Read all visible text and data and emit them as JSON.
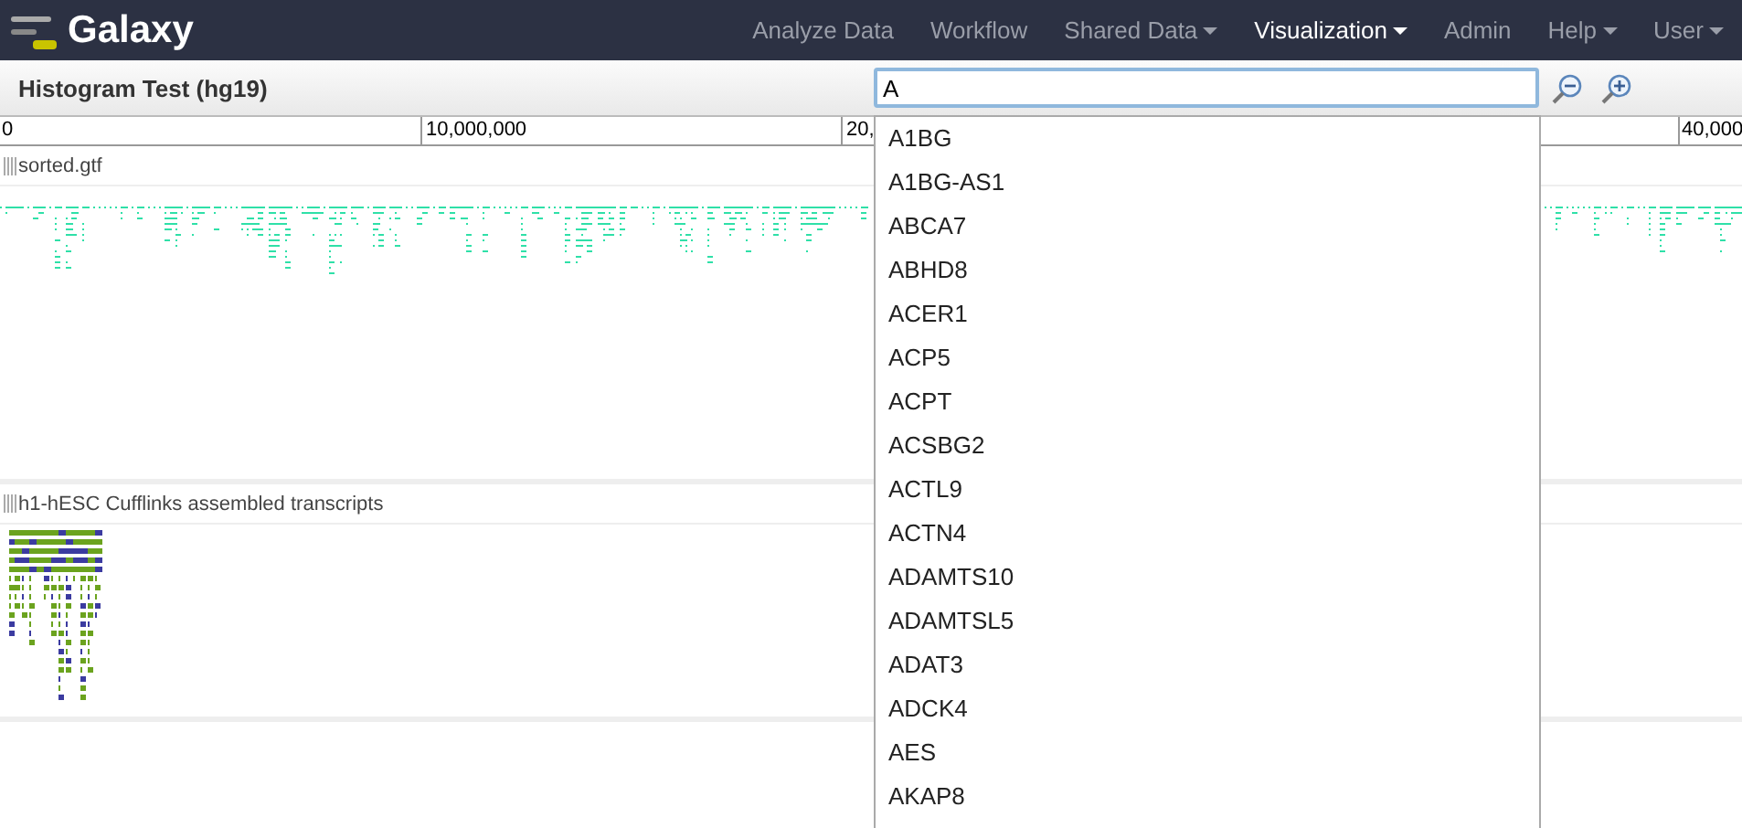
{
  "navbar": {
    "brand": "Galaxy",
    "items": [
      {
        "label": "Analyze Data",
        "has_menu": false,
        "selected": false
      },
      {
        "label": "Workflow",
        "has_menu": false,
        "selected": false
      },
      {
        "label": "Shared Data",
        "has_menu": true,
        "selected": false
      },
      {
        "label": "Visualization",
        "has_menu": true,
        "selected": true
      },
      {
        "label": "Admin",
        "has_menu": false,
        "selected": false
      },
      {
        "label": "Help",
        "has_menu": true,
        "selected": false
      },
      {
        "label": "User",
        "has_menu": true,
        "selected": false
      }
    ]
  },
  "title": "Histogram Test (hg19)",
  "search": {
    "value": "A"
  },
  "ruler": [
    "0",
    "10,000,000",
    "20,",
    "40,000"
  ],
  "tracks": [
    {
      "name": "sorted.gtf",
      "kind": "dense"
    },
    {
      "name": "h1-hESC Cufflinks assembled transcripts",
      "kind": "transcripts"
    }
  ],
  "suggestions": [
    "A1BG",
    "A1BG-AS1",
    "ABCA7",
    "ABHD8",
    "ACER1",
    "ACP5",
    "ACPT",
    "ACSBG2",
    "ACTL9",
    "ACTN4",
    "ADAMTS10",
    "ADAMTSL5",
    "ADAT3",
    "ADCK4",
    "AES",
    "AKAP8"
  ]
}
